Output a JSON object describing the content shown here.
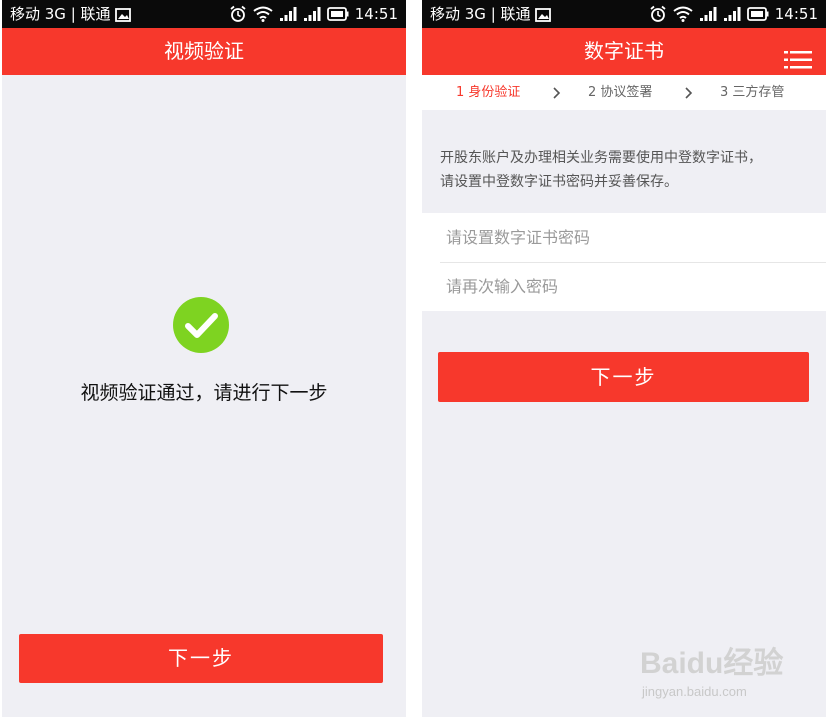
{
  "left_screen": {
    "status_bar": {
      "carrier_text": "移动 3G | 联通",
      "time": "14:51",
      "icons": [
        "image-icon",
        "alarm-icon",
        "wifi-icon",
        "signal-icon",
        "signal-icon",
        "battery-icon"
      ]
    },
    "title": "视频验证",
    "success_icon": "check-circle-icon",
    "message": "视频验证通过，请进行下一步",
    "next_button": "下一步"
  },
  "right_screen": {
    "status_bar": {
      "carrier_text": "移动 3G | 联通",
      "time": "14:51",
      "icons": [
        "image-icon",
        "alarm-icon",
        "wifi-icon",
        "signal-icon",
        "signal-icon",
        "battery-icon"
      ]
    },
    "title": "数字证书",
    "menu_icon": "menu-icon",
    "steps": [
      {
        "label": "1 身份验证",
        "active": true
      },
      {
        "label": "2 协议签署",
        "active": false
      },
      {
        "label": "3 三方存管",
        "active": false
      }
    ],
    "notice_lines": [
      "开股东账户及办理相关业务需要使用中登数字证书，",
      "请设置中登数字证书密码并妥善保存。"
    ],
    "password_placeholder": "请设置数字证书密码",
    "password_confirm_placeholder": "请再次输入密码",
    "next_button": "下一步"
  },
  "watermark": {
    "brand": "Baidu经验",
    "url": "jingyan.baidu.com"
  },
  "colors": {
    "brand_red": "#f7382c",
    "success_green": "#7ed321",
    "background": "#efeff4"
  }
}
